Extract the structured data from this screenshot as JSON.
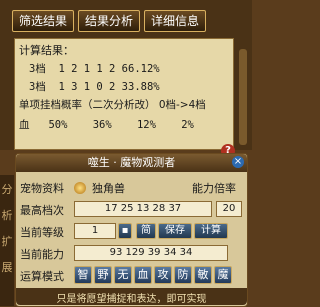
{
  "tabs": [
    "筛选结果",
    "结果分析",
    "详细信息"
  ],
  "results": {
    "header": "计算结果：",
    "rows": [
      "3档  1 2 1 1 2 66.12%",
      "3档  1 3 1 0 2 33.88%"
    ],
    "prob_title": "单项挂档概率（二次分析改） 0档->4档",
    "prob_row": "血   50%    36%    12%    2%"
  },
  "sidebar_chars": [
    "分",
    "析",
    "扩",
    "展"
  ],
  "dialog": {
    "title": "噬生 · 魔物观测者",
    "pet_label": "宠物资料",
    "pet_name": "独角兽",
    "ability_label": "能力倍率",
    "max_label": "最高档次",
    "max_values": "17 25 13 28 37",
    "max_extra": "20",
    "level_label": "当前等级",
    "level_value": "1",
    "simple_btn": "简",
    "save_btn": "保存",
    "calc_btn": "计算",
    "ability_now_label": "当前能力",
    "ability_values": "93 129 39 34 34",
    "mode_label": "运算模式",
    "modes": [
      "智",
      "野",
      "无",
      "血",
      "攻",
      "防",
      "敏",
      "魔"
    ],
    "footer": "只是将愿望捕捉和表达，即可实现"
  },
  "accent": "#d8b060"
}
